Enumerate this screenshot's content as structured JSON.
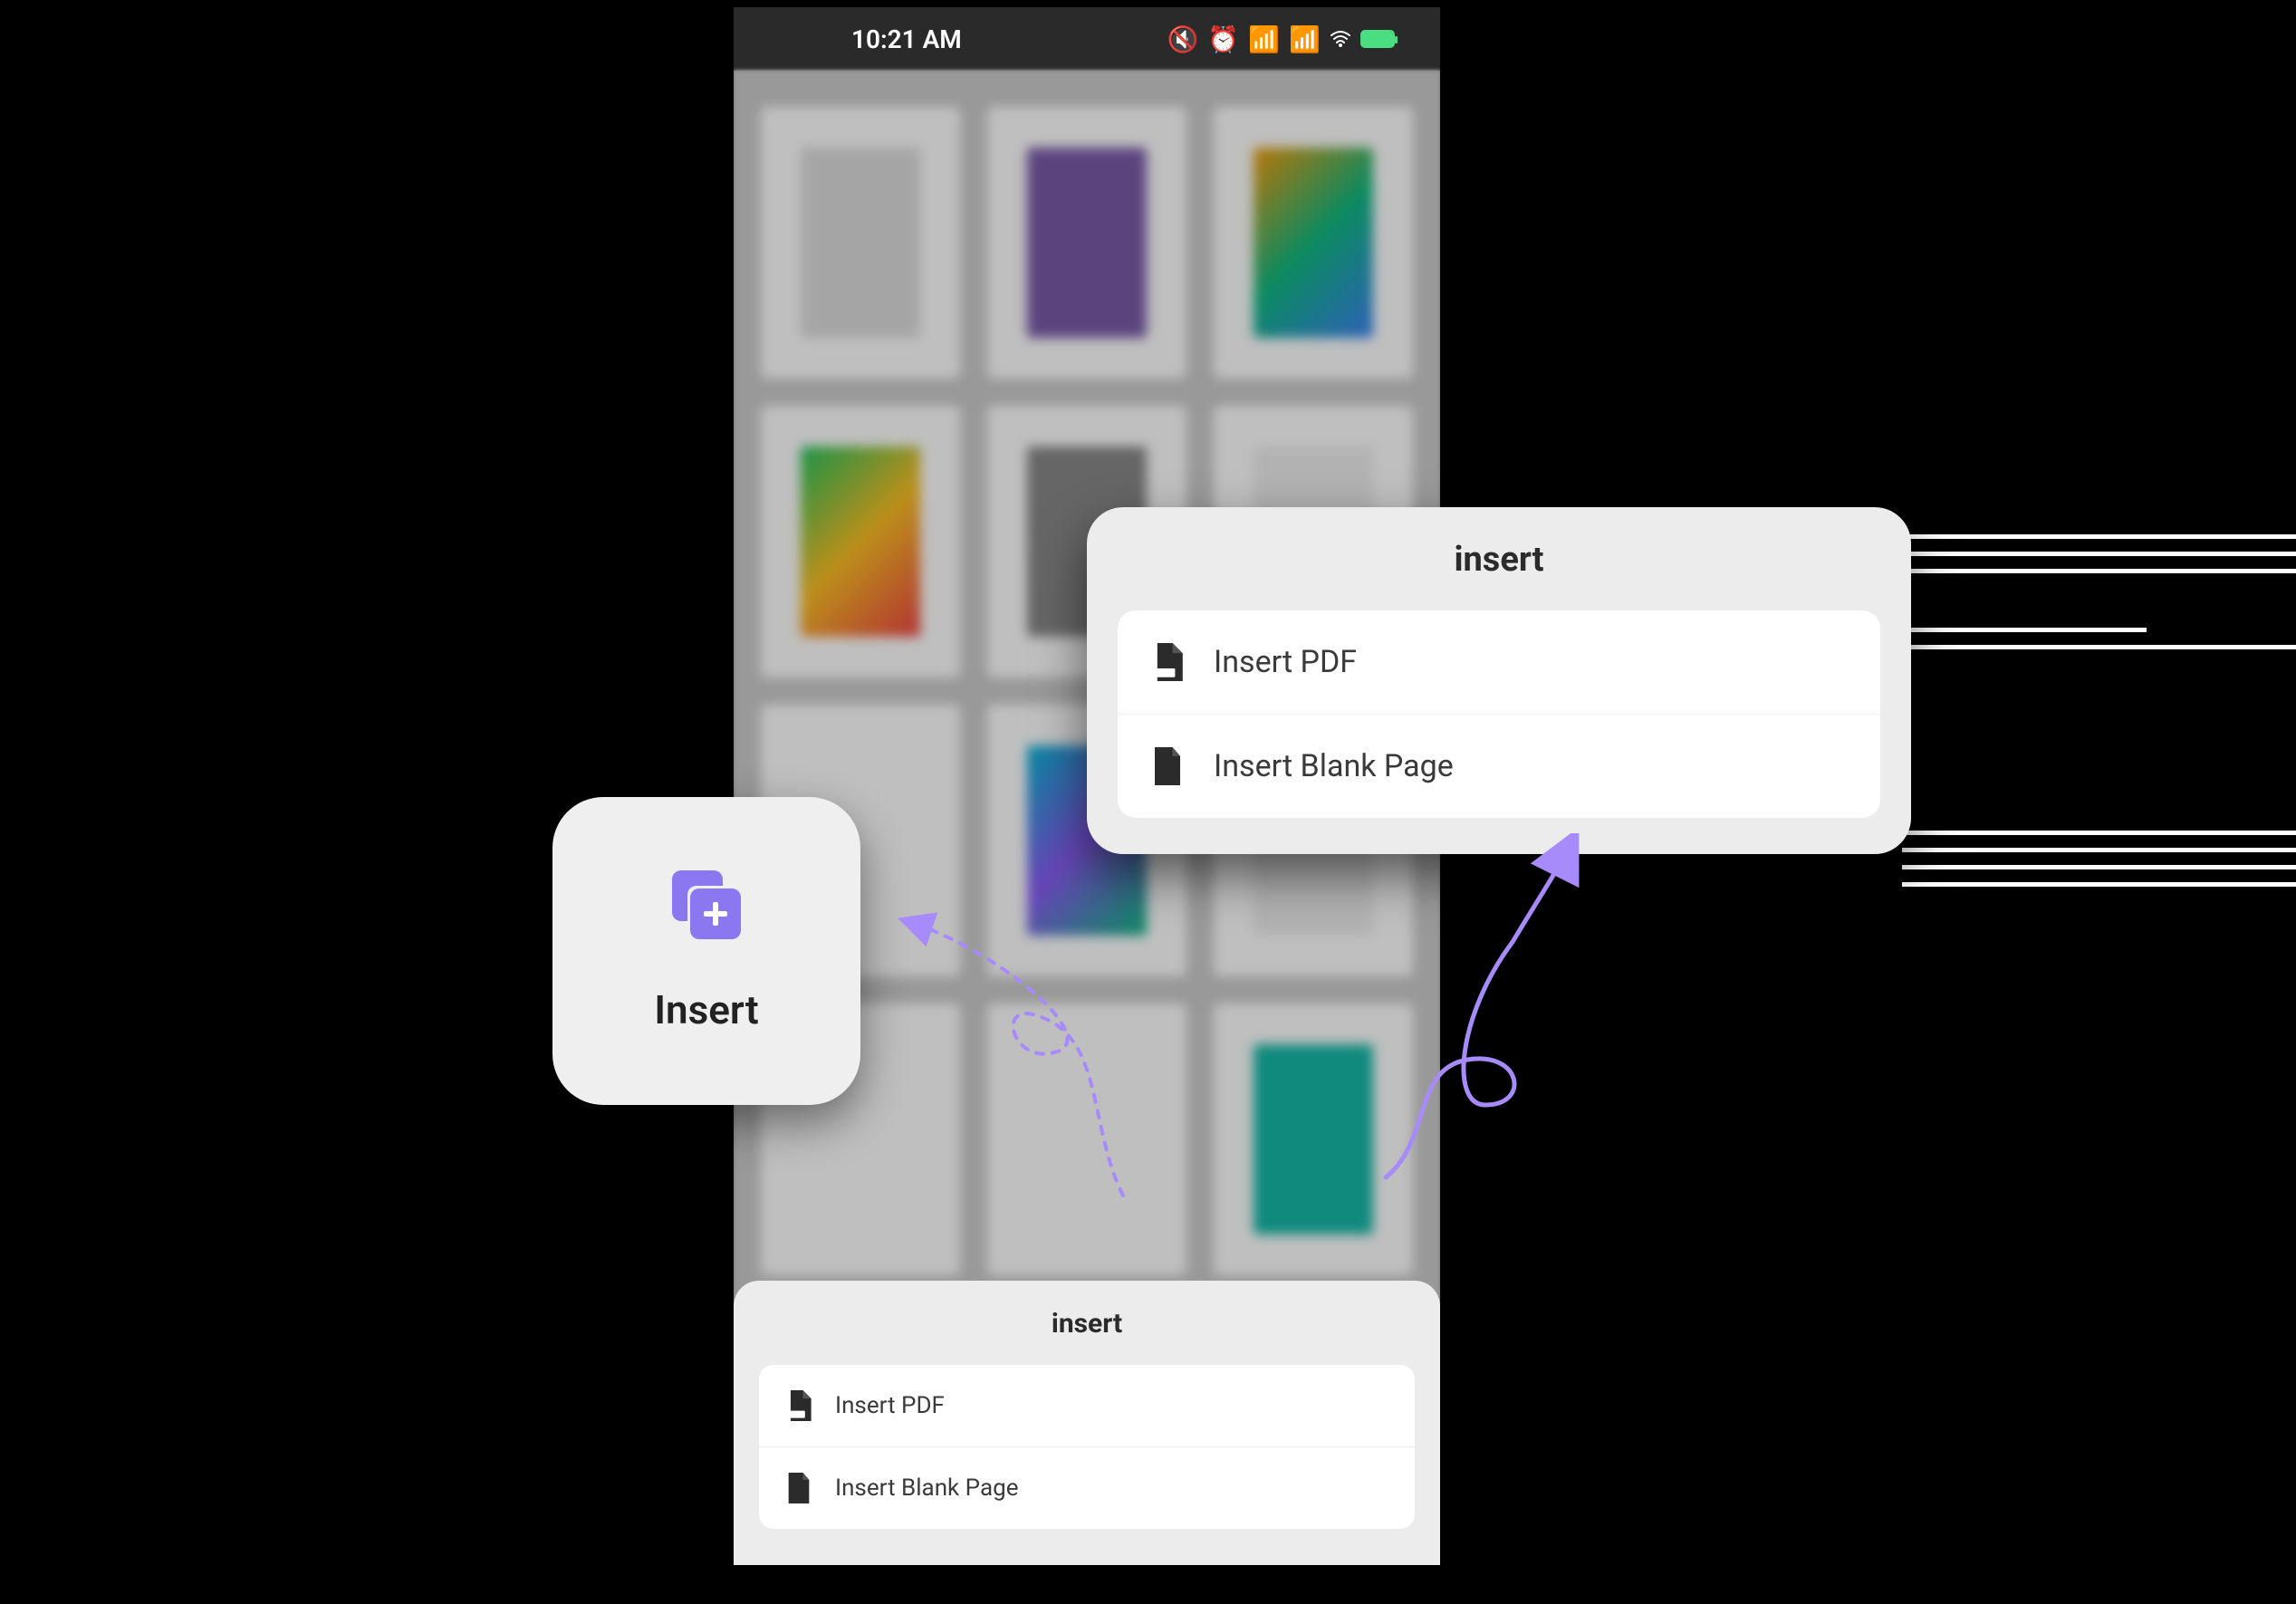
{
  "status_bar": {
    "time": "10:21 AM"
  },
  "insert_button": {
    "label": "Insert"
  },
  "sheet": {
    "title": "insert",
    "options": [
      {
        "label": "Insert PDF",
        "icon": "pdf-file"
      },
      {
        "label": "Insert Blank Page",
        "icon": "blank-file"
      }
    ]
  },
  "callout": {
    "title": "insert",
    "options": [
      {
        "label": "Insert PDF",
        "icon": "pdf-file"
      },
      {
        "label": "Insert Blank Page",
        "icon": "blank-file"
      }
    ]
  },
  "colors": {
    "accent": "#8b78f0",
    "sheet_bg": "#ececec",
    "text": "#2b2b2b"
  }
}
